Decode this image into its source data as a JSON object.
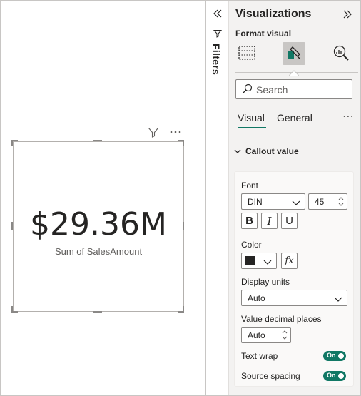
{
  "card": {
    "value": "$29.36M",
    "label": "Sum of SalesAmount"
  },
  "filters_pane": {
    "label": "Filters"
  },
  "pane": {
    "title": "Visualizations",
    "subtitle": "Format visual",
    "search_placeholder": "Search",
    "tabs": [
      {
        "label": "Visual",
        "active": true
      },
      {
        "label": "General",
        "active": false
      }
    ],
    "more": "⋯",
    "section_title": "Callout value",
    "font_label": "Font",
    "font_family": "DIN",
    "font_size": "45",
    "bold": "B",
    "italic": "I",
    "underline": "U",
    "color_label": "Color",
    "color_value": "#252423",
    "fx": "fx",
    "display_units_label": "Display units",
    "display_units_value": "Auto",
    "decimal_places_label": "Value decimal places",
    "decimal_places_value": "Auto",
    "text_wrap_label": "Text wrap",
    "text_wrap_value": "On",
    "source_spacing_label": "Source spacing",
    "source_spacing_value": "On"
  },
  "colors": {
    "accent": "#117865",
    "pane_bg": "#f3f2f1"
  }
}
